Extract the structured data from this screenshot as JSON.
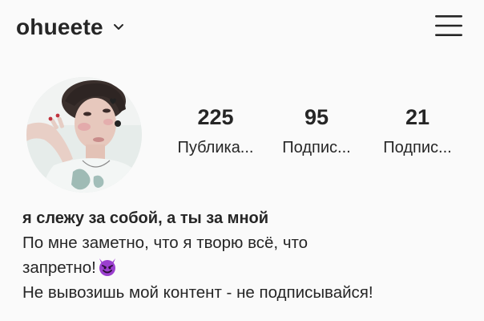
{
  "header": {
    "username": "ohueete",
    "chevron_icon": "chevron-down-icon",
    "menu_icon": "hamburger-menu-icon"
  },
  "stats": [
    {
      "value": "225",
      "label": "Публика..."
    },
    {
      "value": "95",
      "label": "Подпис..."
    },
    {
      "value": "21",
      "label": "Подпис..."
    }
  ],
  "bio": {
    "name": "я слежу за собой, а ты за мной",
    "line1": "По мне заметно, что я творю всё, что",
    "line2": "запретно!",
    "line2_emoji": "smiling-devil-emoji",
    "line3": "Не вывозишь мой контент - не подписывайся!"
  },
  "colors": {
    "background": "#fafafa",
    "text": "#262626",
    "emoji": "#9b3fcf"
  }
}
